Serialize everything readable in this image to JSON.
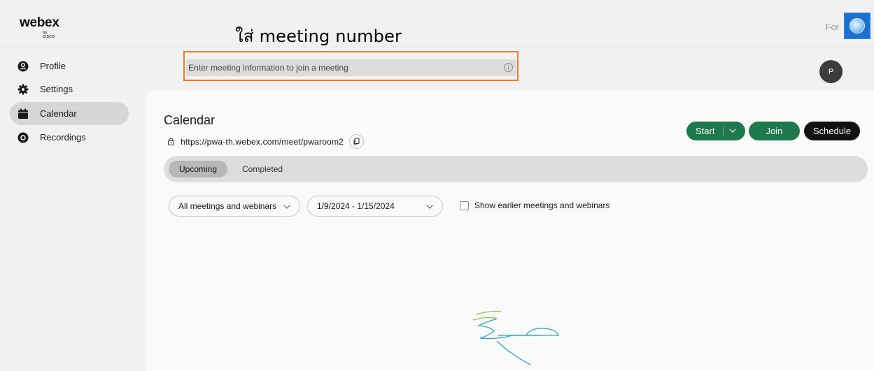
{
  "header": {
    "brand": "webex",
    "brand_sub": "by CISCO",
    "for_label": "For",
    "annotation": "ใส่ meeting number"
  },
  "sidebar": {
    "items": [
      {
        "label": "Profile",
        "icon": "profile-icon",
        "active": false
      },
      {
        "label": "Settings",
        "icon": "gear-icon",
        "active": false
      },
      {
        "label": "Calendar",
        "icon": "calendar-icon",
        "active": true
      },
      {
        "label": "Recordings",
        "icon": "recordings-icon",
        "active": false
      }
    ]
  },
  "search": {
    "placeholder": "Enter meeting information to join a meeting",
    "value": ""
  },
  "user": {
    "avatar_initial": "P"
  },
  "page": {
    "title": "Calendar",
    "meeting_link": "https://pwa-th.webex.com/meet/pwaroom2"
  },
  "actions": {
    "start_label": "Start",
    "join_label": "Join",
    "schedule_label": "Schedule"
  },
  "tabs": [
    {
      "label": "Upcoming",
      "active": true
    },
    {
      "label": "Completed",
      "active": false
    }
  ],
  "filters": {
    "type_selected": "All meetings and webinars",
    "date_range": "1/9/2024 - 1/15/2024",
    "show_earlier_label": "Show earlier meetings and webinars",
    "show_earlier_checked": false
  },
  "colors": {
    "accent_green": "#1e7a4e",
    "annotation_border": "#ed7d31"
  }
}
